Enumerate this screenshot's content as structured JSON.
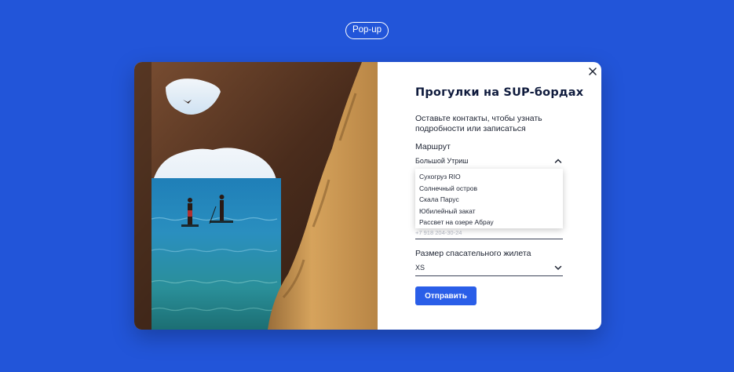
{
  "badge": "Pop-up",
  "modal": {
    "title": "Прогулки на SUP-бордах",
    "subtitle": "Оставьте контакты, чтобы  узнать подробности или  записаться",
    "route": {
      "label": "Маршрут",
      "value": "Большой Утриш",
      "options": [
        "Сухогруз RIO",
        "Солнечный остров",
        "Скала Парус",
        "Юбилейный закат",
        "Рассвет на озере Абрау"
      ]
    },
    "phone": {
      "placeholder": "+7 918 204-30-24"
    },
    "vest": {
      "label": "Размер спасательного жилета",
      "value": "XS"
    },
    "submit_label": "Отправить",
    "icons": {
      "close": "close-icon",
      "route_chevron": "chevron-up-icon",
      "vest_chevron": "chevron-down-icon"
    }
  },
  "colors": {
    "background": "#2255d9",
    "button": "#2a5ee8",
    "title": "#0f1b3d"
  }
}
